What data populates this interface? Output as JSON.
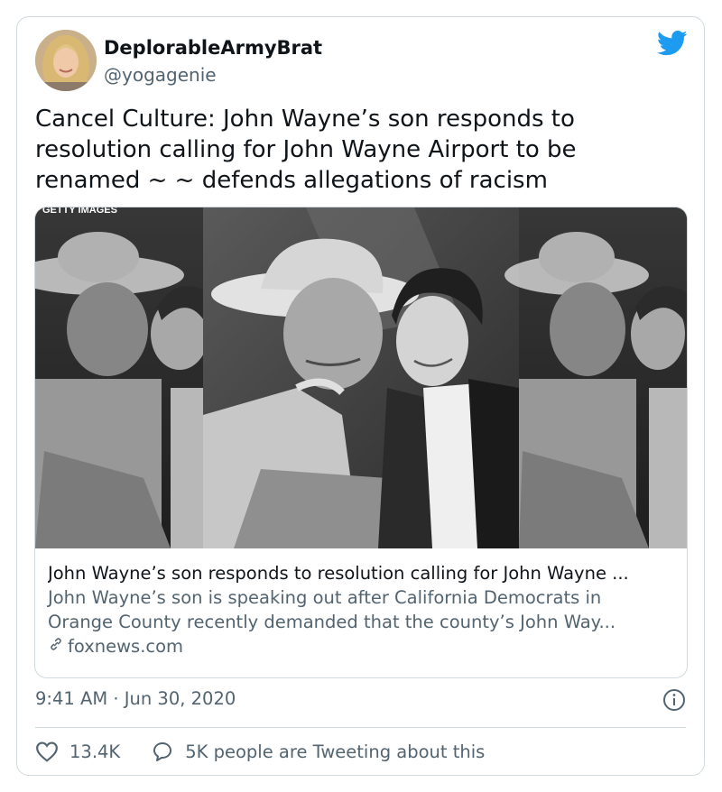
{
  "author": {
    "display_name": "DeplorableArmyBrat",
    "handle": "@yogagenie"
  },
  "tweet": {
    "text_line1": "Cancel Culture: John Wayne’s son responds to",
    "text_line2": "resolution calling for John Wayne Airport to be",
    "text_line3": "renamed ~ ~ defends allegations of racism",
    "timestamp": "9:41 AM · Jun 30, 2020"
  },
  "link_card": {
    "watermark": "GETTY IMAGES",
    "title": "John Wayne’s son responds to resolution calling for John Wayne ...",
    "description_line1": "John Wayne’s son is speaking out after California Democrats in",
    "description_line2": "Orange County recently demanded that the county’s John Way...",
    "domain": "foxnews.com"
  },
  "actions": {
    "likes": "13.4K",
    "reply_text": "5K people are Tweeting about this"
  },
  "colors": {
    "twitter_blue": "#1d9bf0",
    "text_primary": "#0f1419",
    "text_secondary": "#536471",
    "border": "#cfd9de"
  },
  "icons": [
    "twitter-bird-icon",
    "link-icon",
    "info-icon",
    "heart-icon",
    "reply-bubble-icon"
  ]
}
